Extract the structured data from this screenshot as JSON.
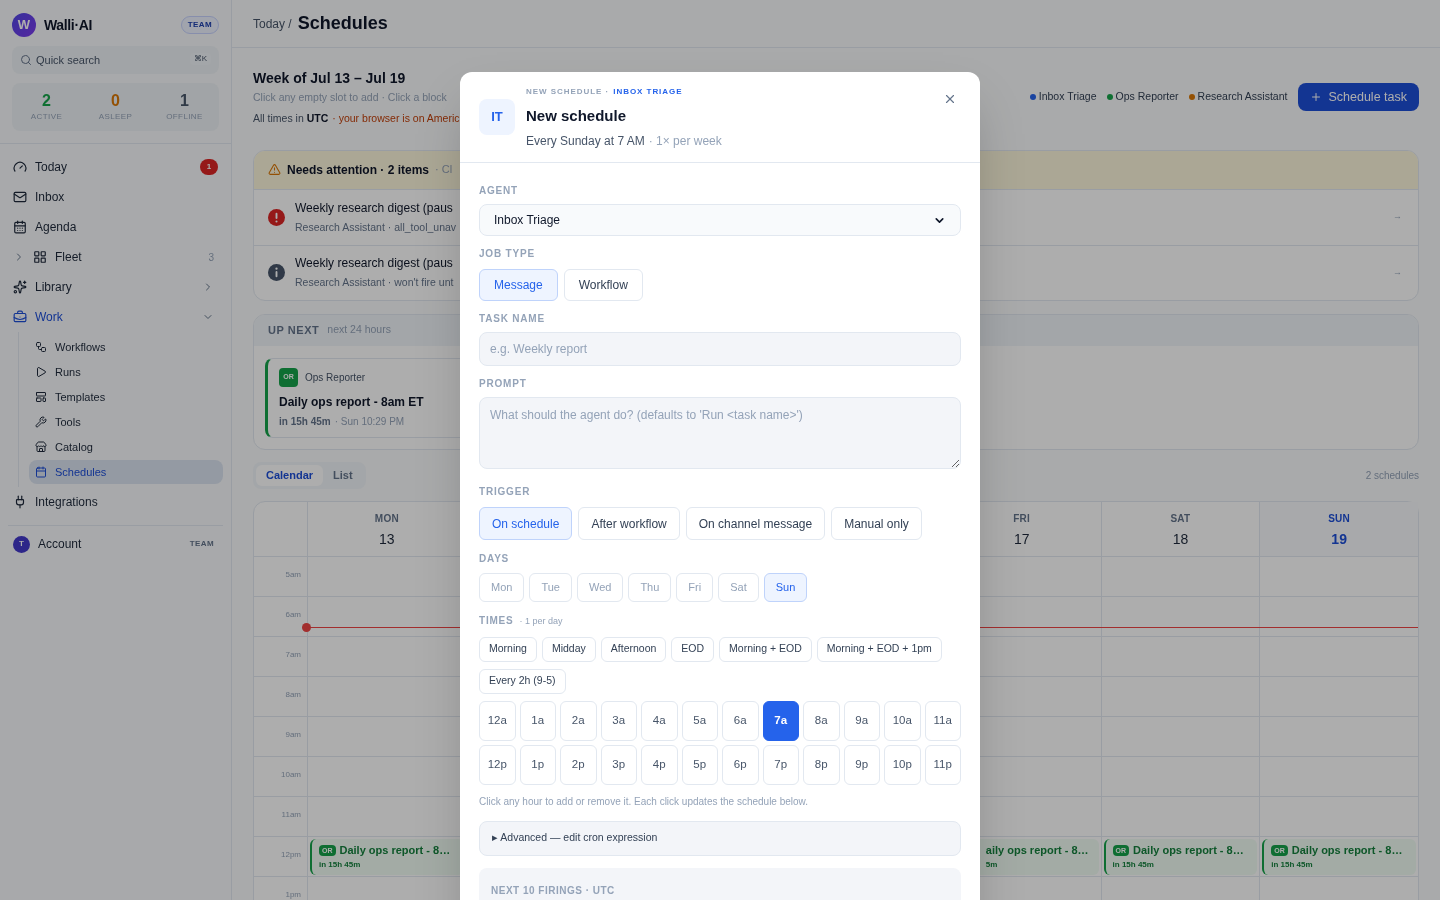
{
  "sidebar": {
    "brand": {
      "logo": "W",
      "name": "Walli·AI",
      "plan": "TEAM"
    },
    "search": {
      "placeholder": "Quick search",
      "shortcut": "⌘K"
    },
    "stats": [
      {
        "value": "2",
        "label": "ACTIVE",
        "color": "#0f6f32"
      },
      {
        "value": "0",
        "label": "ASLEEP",
        "color": "#945104"
      },
      {
        "value": "1",
        "label": "OFFLINE",
        "color": "#303a47"
      }
    ],
    "nav": [
      {
        "kind": "link",
        "label": "Today",
        "badge": "1",
        "selected": false
      },
      {
        "kind": "link",
        "label": "Inbox",
        "selected": false
      },
      {
        "kind": "link",
        "label": "Agenda",
        "selected": false
      },
      {
        "kind": "group",
        "label": "Fleet",
        "count": "3",
        "expanded": false,
        "selected": false
      },
      {
        "kind": "menu",
        "label": "Library",
        "expanded": false,
        "selected": false
      },
      {
        "kind": "menu",
        "label": "Work",
        "expanded": true,
        "selected": true,
        "children": [
          {
            "label": "Workflows",
            "selected": false
          },
          {
            "label": "Runs",
            "selected": false
          },
          {
            "label": "Templates",
            "selected": false
          },
          {
            "label": "Tools",
            "selected": false
          },
          {
            "label": "Catalog",
            "selected": false
          },
          {
            "label": "Schedules",
            "selected": true
          }
        ]
      },
      {
        "kind": "link",
        "label": "Integrations",
        "selected": false
      }
    ],
    "account": {
      "avatar": "T",
      "label": "Account",
      "plan": "TEAM"
    }
  },
  "header": {
    "breadcrumb": "Today /",
    "title": "Schedules"
  },
  "week": {
    "title": "Week of Jul 13 – Jul 19",
    "hint": "Click any empty slot to add · Click a block",
    "timezone_prefix": "All times in",
    "timezone": "UTC",
    "timezone_note": "· your browser is on Americ"
  },
  "legend": [
    {
      "label": "Inbox Triage",
      "color": "#1943a0"
    },
    {
      "label": "Ops Reporter",
      "color": "#0f6f32"
    },
    {
      "label": "Research Assistant",
      "color": "#945104"
    }
  ],
  "schedule_button": "Schedule task",
  "attention": {
    "title": "Needs attention · 2 items",
    "note": "· Cl",
    "items": [
      {
        "kind": "error",
        "title": "Weekly research digest (paus",
        "detail": "Research Assistant · all_tool_unav",
        "arrow": "→"
      },
      {
        "kind": "info",
        "title": "Weekly research digest (paus",
        "detail": "Research Assistant · won't fire unt",
        "arrow": "→"
      }
    ]
  },
  "up_next": {
    "title": "UP NEXT",
    "subtitle": "next 24 hours",
    "items": [
      {
        "badge": "OR",
        "agent": "Ops Reporter",
        "title": "Daily ops report - 8am ET",
        "eta": "in 15h 45m",
        "when": "· Sun 10:29 PM"
      }
    ]
  },
  "view_tabs": [
    {
      "label": "Calendar",
      "selected": true
    },
    {
      "label": "List",
      "selected": false
    }
  ],
  "schedule_count": "2 schedules",
  "calendar": {
    "hours": [
      "5am",
      "6am",
      "7am",
      "8am",
      "9am",
      "10am",
      "11am",
      "12pm",
      "1pm"
    ],
    "days": [
      {
        "day": "MON",
        "date": "13",
        "today": false,
        "events": [
          {
            "partial": false,
            "badge": "OR",
            "title": "Daily ops report - 8…",
            "eta": "in 15h 45m"
          }
        ]
      },
      {
        "day": "FRI",
        "date": "17",
        "today": false,
        "events": [
          {
            "partial": true,
            "title": "aily ops report - 8…",
            "eta": "5m"
          }
        ]
      },
      {
        "day": "SAT",
        "date": "18",
        "today": false,
        "events": [
          {
            "partial": false,
            "badge": "OR",
            "title": "Daily ops report - 8…",
            "eta": "in 15h 45m"
          }
        ]
      },
      {
        "day": "SUN",
        "date": "19",
        "today": true,
        "events": [
          {
            "partial": false,
            "badge": "OR",
            "title": "Daily ops report - 8…",
            "eta": "in 15h 45m"
          }
        ]
      }
    ]
  },
  "modal": {
    "avatar": "IT",
    "eyebrow": "NEW SCHEDULE ·",
    "eyebrow_agent": "INBOX TRIAGE",
    "title": "New schedule",
    "summary": "Every Sunday at 7 AM",
    "frequency": "· 1× per week",
    "agent": {
      "label": "AGENT",
      "value": "Inbox Triage"
    },
    "job_type": {
      "label": "JOB TYPE",
      "options": [
        {
          "label": "Message",
          "selected": true
        },
        {
          "label": "Workflow",
          "selected": false
        }
      ]
    },
    "task_name": {
      "label": "TASK NAME",
      "placeholder": "e.g. Weekly report"
    },
    "prompt": {
      "label": "PROMPT",
      "placeholder": "What should the agent do? (defaults to 'Run <task name>')"
    },
    "trigger": {
      "label": "TRIGGER",
      "options": [
        {
          "label": "On schedule",
          "selected": true
        },
        {
          "label": "After workflow",
          "selected": false
        },
        {
          "label": "On channel message",
          "selected": false
        },
        {
          "label": "Manual only",
          "selected": false
        }
      ]
    },
    "days": {
      "label": "DAYS",
      "options": [
        {
          "label": "Mon",
          "selected": false
        },
        {
          "label": "Tue",
          "selected": false
        },
        {
          "label": "Wed",
          "selected": false
        },
        {
          "label": "Thu",
          "selected": false
        },
        {
          "label": "Fri",
          "selected": false
        },
        {
          "label": "Sat",
          "selected": false
        },
        {
          "label": "Sun",
          "selected": true
        }
      ]
    },
    "times": {
      "label": "TIMES",
      "note": "· 1 per day",
      "presets": [
        "Morning",
        "Midday",
        "Afternoon",
        "EOD",
        "Morning + EOD",
        "Morning + EOD + 1pm",
        "Every 2h (9-5)"
      ],
      "hours": [
        {
          "label": "12a",
          "selected": false
        },
        {
          "label": "1a",
          "selected": false
        },
        {
          "label": "2a",
          "selected": false
        },
        {
          "label": "3a",
          "selected": false
        },
        {
          "label": "4a",
          "selected": false
        },
        {
          "label": "5a",
          "selected": false
        },
        {
          "label": "6a",
          "selected": false
        },
        {
          "label": "7a",
          "selected": true
        },
        {
          "label": "8a",
          "selected": false
        },
        {
          "label": "9a",
          "selected": false
        },
        {
          "label": "10a",
          "selected": false
        },
        {
          "label": "11a",
          "selected": false
        },
        {
          "label": "12p",
          "selected": false
        },
        {
          "label": "1p",
          "selected": false
        },
        {
          "label": "2p",
          "selected": false
        },
        {
          "label": "3p",
          "selected": false
        },
        {
          "label": "4p",
          "selected": false
        },
        {
          "label": "5p",
          "selected": false
        },
        {
          "label": "6p",
          "selected": false
        },
        {
          "label": "7p",
          "selected": false
        },
        {
          "label": "8p",
          "selected": false
        },
        {
          "label": "9p",
          "selected": false
        },
        {
          "label": "10p",
          "selected": false
        },
        {
          "label": "11p",
          "selected": false
        }
      ],
      "hint": "Click any hour to add or remove it. Each click updates the schedule below."
    },
    "advanced": {
      "label": "▸ Advanced — edit cron expression",
      "expanded": false
    },
    "firings": {
      "title": "NEXT 10 FIRINGS · UTC"
    }
  }
}
